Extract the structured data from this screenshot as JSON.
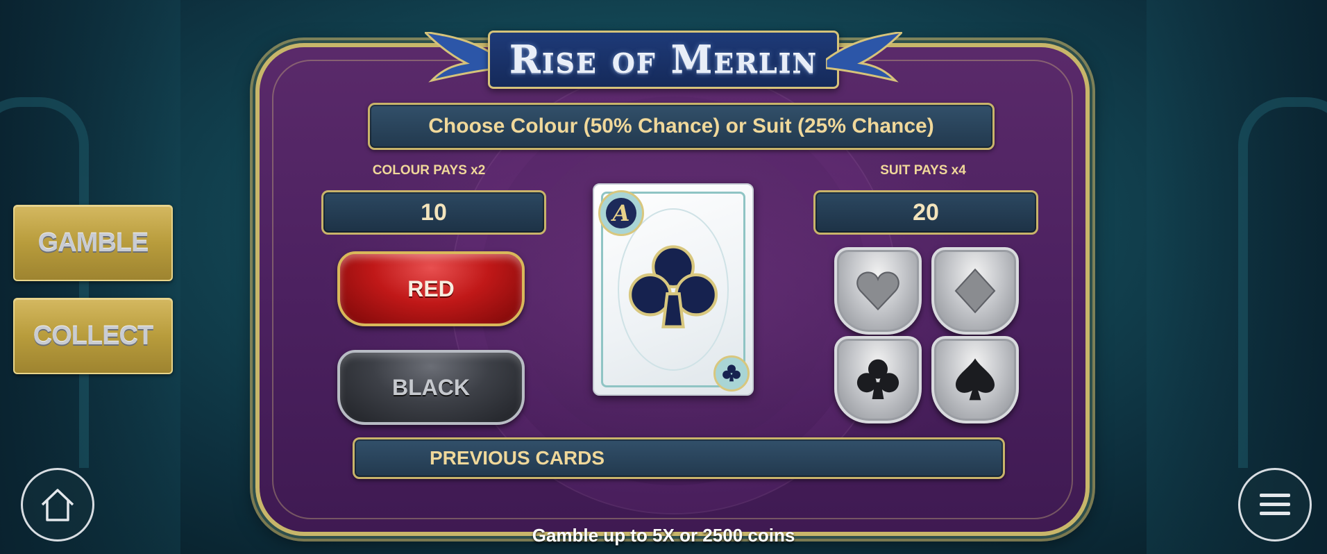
{
  "game": {
    "logo_text": "Rise of Merlin",
    "title": "Choose Colour (50% Chance) or Suit (25% Chance)",
    "colour_pays_label": "COLOUR PAYS x2",
    "colour_pays_value": "10",
    "suit_pays_label": "SUIT PAYS x4",
    "suit_pays_value": "20",
    "red_label": "RED",
    "black_label": "BLACK",
    "previous_cards_label": "PREVIOUS CARDS",
    "footer": "Gamble up to 5X or 2500 coins",
    "card": {
      "rank": "A",
      "suit": "clubs"
    },
    "suits": [
      "hearts",
      "diamonds",
      "clubs",
      "spades"
    ]
  },
  "side": {
    "gamble_label": "GAMBLE",
    "collect_label": "COLLECT"
  },
  "icons": {
    "home": "home-icon",
    "menu": "menu-icon"
  },
  "colors": {
    "gold": "#c9b46a",
    "panel_purple": "#4c2160",
    "red": "#c01818",
    "banner_text": "#f0d89a"
  }
}
